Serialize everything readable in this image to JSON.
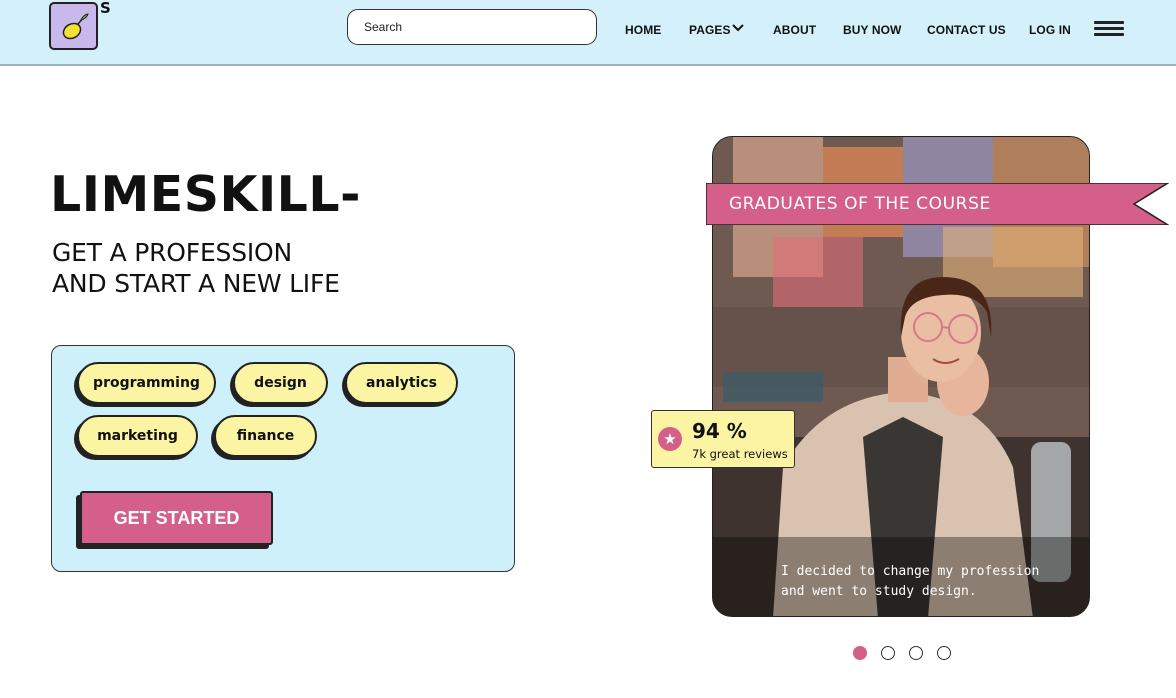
{
  "header": {
    "logo_letter": "S",
    "search": {
      "placeholder": "Search",
      "value": ""
    },
    "nav": {
      "home": "HOME",
      "pages": "PAGES",
      "about": "ABOUT",
      "buy_now": "BUY NOW",
      "contact_us": "CONTACT US",
      "log_in": "LOG IN"
    },
    "icons": [
      "lemon-logo-icon",
      "chevron-down-icon",
      "hamburger-menu-icon"
    ]
  },
  "hero": {
    "brand": "LIMESKILL-",
    "tagline_line1": "GET A PROFESSION",
    "tagline_line2": "AND START A NEW LIFE"
  },
  "skills": {
    "tags": [
      "programming",
      "design",
      "analytics",
      "marketing",
      "finance"
    ],
    "cta_label": "GET STARTED"
  },
  "graduates": {
    "ribbon_label": "GRADUATES OF THE COURSE",
    "rating_value": "94 %",
    "rating_caption": "7k great reviews",
    "quote_line1": "I decided to change my profession",
    "quote_line2": "and went to study design.",
    "carousel": {
      "slide_count": 4,
      "active_index": 0
    }
  },
  "colors": {
    "header_bg": "#d4f1fb",
    "card_bg": "#cdf0fb",
    "pill_bg": "#fbf4a3",
    "accent_pink": "#d45f88",
    "logo_bg": "#c9b8ec"
  }
}
